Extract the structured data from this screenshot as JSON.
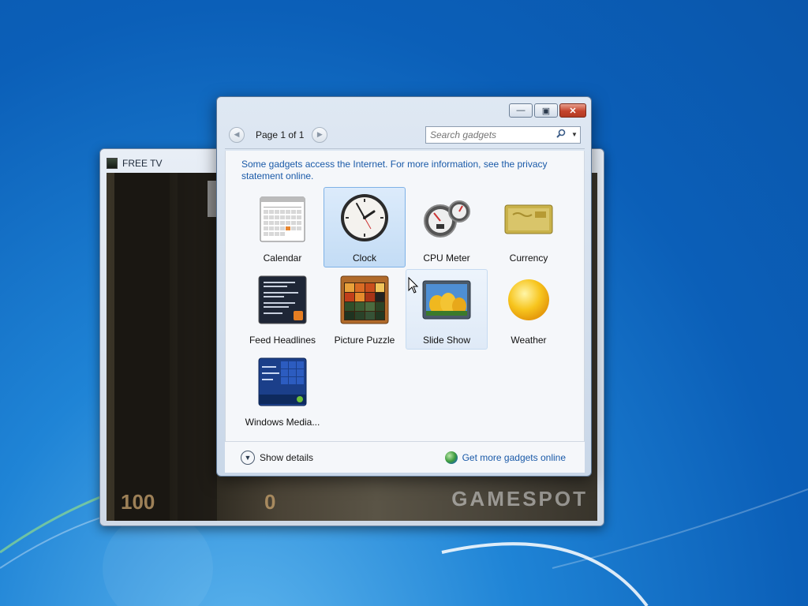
{
  "tv_window": {
    "title": "FREE TV",
    "hud_left": "100",
    "hud_mid": "0",
    "hud_right": "GAMESPOT"
  },
  "gadgets_window": {
    "pager": {
      "prev_icon": "chevron-left-icon",
      "page_label": "Page 1 of 1",
      "next_icon": "chevron-right-icon"
    },
    "search": {
      "placeholder": "Search gadgets",
      "icon": "search-icon",
      "dropdown_icon": "chevron-down-icon"
    },
    "info_text": "Some gadgets access the Internet.  For more information, see the privacy statement online.",
    "gadgets": [
      {
        "label": "Calendar",
        "icon": "calendar-icon",
        "state": "normal"
      },
      {
        "label": "Clock",
        "icon": "clock-icon",
        "state": "selected"
      },
      {
        "label": "CPU Meter",
        "icon": "cpu-meter-icon",
        "state": "normal"
      },
      {
        "label": "Currency",
        "icon": "currency-icon",
        "state": "normal"
      },
      {
        "label": "Feed Headlines",
        "icon": "feed-headlines-icon",
        "state": "normal"
      },
      {
        "label": "Picture Puzzle",
        "icon": "picture-puzzle-icon",
        "state": "normal"
      },
      {
        "label": "Slide Show",
        "icon": "slide-show-icon",
        "state": "hover"
      },
      {
        "label": "Weather",
        "icon": "weather-icon",
        "state": "normal"
      },
      {
        "label": "Windows Media...",
        "icon": "windows-media-center-icon",
        "state": "normal"
      }
    ],
    "footer": {
      "show_details_label": "Show details",
      "get_more_label": "Get more gadgets online",
      "get_more_icon": "globe-icon"
    }
  },
  "colors": {
    "desktop_blue": "#0b5fb8",
    "link_blue": "#1a5aa8",
    "selection": "#c3dcf5",
    "close_red": "#c4442c"
  }
}
